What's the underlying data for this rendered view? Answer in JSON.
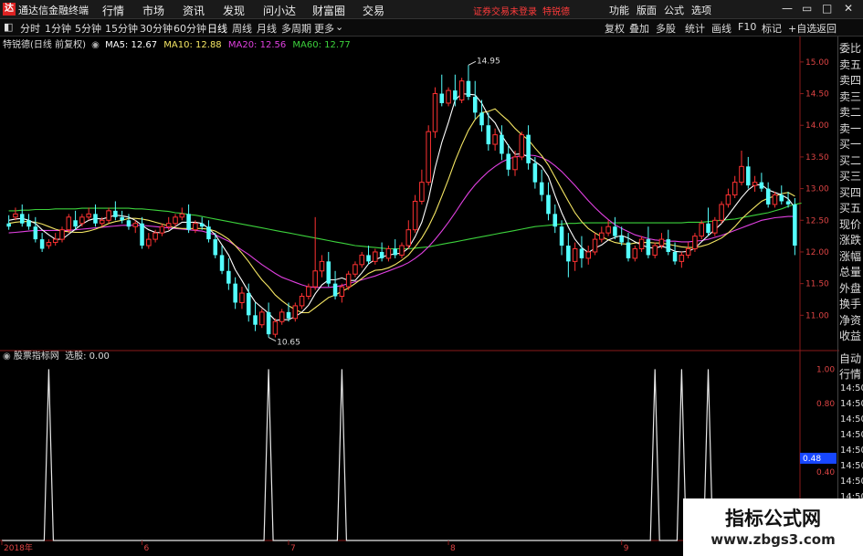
{
  "window": {
    "app_title": "通达信金融终端",
    "menu": [
      "行情",
      "市场",
      "资讯",
      "发现",
      "问小达",
      "财富圈",
      "交易"
    ],
    "notice": "证券交易未登录",
    "notice_user": "特锐德",
    "right_menu": [
      "功能",
      "版面",
      "公式",
      "选项"
    ]
  },
  "toolbar": {
    "periods": [
      "分时",
      "1分钟",
      "5分钟",
      "15分钟",
      "30分钟",
      "60分钟",
      "日线",
      "周线",
      "月线",
      "多周期",
      "更多"
    ],
    "active_period": "日线",
    "right_buttons": [
      "复权",
      "叠加",
      "多股",
      "统计",
      "画线",
      "F10",
      "标记",
      "+自选",
      "返回"
    ]
  },
  "ma_line": {
    "stock": "特锐德(日线 前复权)",
    "ma5": "MA5: 12.67",
    "ma10": "MA10: 12.88",
    "ma20": "MA20: 12.56",
    "ma60": "MA60: 12.77",
    "colors": {
      "ma5": "#ffffff",
      "ma10": "#f5e663",
      "ma20": "#e040e0",
      "ma60": "#3cd23c"
    }
  },
  "lower_panel": {
    "indicator": "股票指标网",
    "signal_label": "选股: 0.00",
    "axis": [
      "1.00",
      "0.80",
      "0.48",
      "0.40",
      "0.20"
    ],
    "current": "0.48"
  },
  "price_axis": [
    "15.00",
    "14.50",
    "14.00",
    "13.50",
    "13.00",
    "12.50",
    "12.00",
    "11.50",
    "11.00"
  ],
  "annotations": {
    "high": "14.95",
    "low": "10.65"
  },
  "date_axis": [
    "2018年",
    "6",
    "7",
    "8",
    "9"
  ],
  "side_panel": {
    "top_labels": [
      "委比",
      "卖五",
      "卖四",
      "卖三",
      "卖二",
      "卖一",
      "买一",
      "买二",
      "买三",
      "买四",
      "买五",
      "现价",
      "涨跌",
      "涨幅",
      "总量",
      "外盘",
      "换手",
      "净资",
      "收益"
    ],
    "bottom_labels": [
      "自动",
      "行情"
    ],
    "times": [
      "14:50",
      "14:50",
      "14:50",
      "14:50",
      "14:50",
      "14:50",
      "14:50",
      "14:50"
    ]
  },
  "watermark": {
    "line1": "指标公式网",
    "line2": "www.zbgs3.com"
  },
  "chart_data": {
    "type": "candlestick",
    "ylim": [
      10.5,
      15.2
    ],
    "candles": [
      [
        12.45,
        12.58,
        12.4,
        12.35
      ],
      [
        12.55,
        12.7,
        12.6,
        12.5
      ],
      [
        12.6,
        12.75,
        12.45,
        12.4
      ],
      [
        12.5,
        12.6,
        12.4,
        12.35
      ],
      [
        12.4,
        12.55,
        12.2,
        12.15
      ],
      [
        12.2,
        12.3,
        12.05,
        12.0
      ],
      [
        12.1,
        12.2,
        12.15,
        12.05
      ],
      [
        12.15,
        12.3,
        12.2,
        12.1
      ],
      [
        12.2,
        12.4,
        12.35,
        12.15
      ],
      [
        12.35,
        12.6,
        12.55,
        12.3
      ],
      [
        12.5,
        12.65,
        12.4,
        12.35
      ],
      [
        12.45,
        12.6,
        12.55,
        12.4
      ],
      [
        12.55,
        12.7,
        12.6,
        12.5
      ],
      [
        12.6,
        12.75,
        12.45,
        12.4
      ],
      [
        12.45,
        12.55,
        12.5,
        12.4
      ],
      [
        12.5,
        12.7,
        12.65,
        12.45
      ],
      [
        12.65,
        12.8,
        12.55,
        12.5
      ],
      [
        12.55,
        12.65,
        12.5,
        12.45
      ],
      [
        12.5,
        12.6,
        12.4,
        12.35
      ],
      [
        12.4,
        12.5,
        12.45,
        12.3
      ],
      [
        12.45,
        12.55,
        12.1,
        12.05
      ],
      [
        12.1,
        12.3,
        12.2,
        12.05
      ],
      [
        12.2,
        12.35,
        12.3,
        12.15
      ],
      [
        12.3,
        12.45,
        12.4,
        12.25
      ],
      [
        12.4,
        12.55,
        12.45,
        12.35
      ],
      [
        12.45,
        12.6,
        12.55,
        12.4
      ],
      [
        12.55,
        12.7,
        12.6,
        12.5
      ],
      [
        12.6,
        12.75,
        12.35,
        12.3
      ],
      [
        12.35,
        12.5,
        12.45,
        12.3
      ],
      [
        12.45,
        12.55,
        12.4,
        12.35
      ],
      [
        12.4,
        12.5,
        12.2,
        12.15
      ],
      [
        12.2,
        12.3,
        11.95,
        11.9
      ],
      [
        11.95,
        12.1,
        11.7,
        11.65
      ],
      [
        11.7,
        11.9,
        11.5,
        11.4
      ],
      [
        11.5,
        11.6,
        11.2,
        11.1
      ],
      [
        11.2,
        11.45,
        11.35,
        11.1
      ],
      [
        11.35,
        11.5,
        11.0,
        10.9
      ],
      [
        11.0,
        11.2,
        10.85,
        10.75
      ],
      [
        10.85,
        11.1,
        11.05,
        10.8
      ],
      [
        11.05,
        11.2,
        10.7,
        10.65
      ],
      [
        10.7,
        10.95,
        10.9,
        10.65
      ],
      [
        10.9,
        11.1,
        11.05,
        10.85
      ],
      [
        11.05,
        11.2,
        10.95,
        10.9
      ],
      [
        10.95,
        11.2,
        11.15,
        10.9
      ],
      [
        11.15,
        11.35,
        11.3,
        11.1
      ],
      [
        11.3,
        11.5,
        11.45,
        11.25
      ],
      [
        11.45,
        12.55,
        11.7,
        11.4
      ],
      [
        11.7,
        11.95,
        11.85,
        11.6
      ],
      [
        11.85,
        12.0,
        11.5,
        11.45
      ],
      [
        11.5,
        11.7,
        11.3,
        11.25
      ],
      [
        11.3,
        11.5,
        11.45,
        11.2
      ],
      [
        11.45,
        11.7,
        11.65,
        11.4
      ],
      [
        11.65,
        11.85,
        11.8,
        11.6
      ],
      [
        11.8,
        12.0,
        11.95,
        11.75
      ],
      [
        11.95,
        12.1,
        11.85,
        11.8
      ],
      [
        11.85,
        12.05,
        12.0,
        11.8
      ],
      [
        12.0,
        12.15,
        11.9,
        11.85
      ],
      [
        11.9,
        12.1,
        12.05,
        11.85
      ],
      [
        12.05,
        12.2,
        11.95,
        11.9
      ],
      [
        11.95,
        12.15,
        12.1,
        11.9
      ],
      [
        12.1,
        12.5,
        12.35,
        12.05
      ],
      [
        12.35,
        12.9,
        12.8,
        12.3
      ],
      [
        12.8,
        13.3,
        13.1,
        12.75
      ],
      [
        13.1,
        14.0,
        13.9,
        13.05
      ],
      [
        13.9,
        14.6,
        14.5,
        13.8
      ],
      [
        14.5,
        14.8,
        14.35,
        14.3
      ],
      [
        14.35,
        14.6,
        14.55,
        14.3
      ],
      [
        14.55,
        14.8,
        14.4,
        14.3
      ],
      [
        14.4,
        14.75,
        14.7,
        14.35
      ],
      [
        14.7,
        14.95,
        14.45,
        14.4
      ],
      [
        14.45,
        14.7,
        14.2,
        14.1
      ],
      [
        14.2,
        14.4,
        14.0,
        13.9
      ],
      [
        14.0,
        14.2,
        13.7,
        13.6
      ],
      [
        13.7,
        13.95,
        13.85,
        13.6
      ],
      [
        13.85,
        14.0,
        13.55,
        13.45
      ],
      [
        13.55,
        13.7,
        13.3,
        13.2
      ],
      [
        13.3,
        13.6,
        13.5,
        13.2
      ],
      [
        13.5,
        13.9,
        13.85,
        13.45
      ],
      [
        13.85,
        14.0,
        13.4,
        13.3
      ],
      [
        13.4,
        13.5,
        13.1,
        13.0
      ],
      [
        13.1,
        13.3,
        12.9,
        12.8
      ],
      [
        12.9,
        13.1,
        12.6,
        12.5
      ],
      [
        12.6,
        12.75,
        12.4,
        12.3
      ],
      [
        12.4,
        12.5,
        12.1,
        11.95
      ],
      [
        12.1,
        12.3,
        11.85,
        11.6
      ],
      [
        11.85,
        12.15,
        12.05,
        11.7
      ],
      [
        12.05,
        12.25,
        11.9,
        11.75
      ],
      [
        11.9,
        12.1,
        12.0,
        11.8
      ],
      [
        12.0,
        12.3,
        12.2,
        11.95
      ],
      [
        12.2,
        12.4,
        12.3,
        12.15
      ],
      [
        12.3,
        12.5,
        12.4,
        12.25
      ],
      [
        12.4,
        12.55,
        12.25,
        12.2
      ],
      [
        12.25,
        12.4,
        12.15,
        12.1
      ],
      [
        12.15,
        12.3,
        11.9,
        11.85
      ],
      [
        11.9,
        12.1,
        12.05,
        11.85
      ],
      [
        12.05,
        12.25,
        12.2,
        12.0
      ],
      [
        12.2,
        12.4,
        11.95,
        11.9
      ],
      [
        11.95,
        12.15,
        12.1,
        11.9
      ],
      [
        12.1,
        12.3,
        12.2,
        12.05
      ],
      [
        12.2,
        12.35,
        12.0,
        11.95
      ],
      [
        12.0,
        12.15,
        11.85,
        11.8
      ],
      [
        11.85,
        12.0,
        11.95,
        11.75
      ],
      [
        11.95,
        12.15,
        12.05,
        11.9
      ],
      [
        12.05,
        12.3,
        12.25,
        12.0
      ],
      [
        12.25,
        12.5,
        12.45,
        12.2
      ],
      [
        12.45,
        12.7,
        12.3,
        12.25
      ],
      [
        12.3,
        12.55,
        12.5,
        12.25
      ],
      [
        12.5,
        12.8,
        12.75,
        12.45
      ],
      [
        12.75,
        13.0,
        12.9,
        12.7
      ],
      [
        12.9,
        13.2,
        13.1,
        12.85
      ],
      [
        13.1,
        13.6,
        13.35,
        13.05
      ],
      [
        13.35,
        13.5,
        13.05,
        13.0
      ],
      [
        13.05,
        13.2,
        13.1,
        12.95
      ],
      [
        13.1,
        13.25,
        13.0,
        12.95
      ],
      [
        13.0,
        13.1,
        12.75,
        12.7
      ],
      [
        12.75,
        12.95,
        12.9,
        12.7
      ],
      [
        12.9,
        13.05,
        12.8,
        12.75
      ],
      [
        12.8,
        12.95,
        12.75,
        12.7
      ],
      [
        12.75,
        12.85,
        12.1,
        11.95
      ]
    ],
    "ma5": [
      12.5,
      12.52,
      12.53,
      12.5,
      12.45,
      12.35,
      12.27,
      12.2,
      12.2,
      12.28,
      12.36,
      12.44,
      12.5,
      12.53,
      12.52,
      12.55,
      12.58,
      12.57,
      12.55,
      12.5,
      12.42,
      12.35,
      12.31,
      12.3,
      12.33,
      12.4,
      12.47,
      12.47,
      12.47,
      12.45,
      12.37,
      12.27,
      12.11,
      11.95,
      11.72,
      11.55,
      11.37,
      11.21,
      11.12,
      11.03,
      10.92,
      10.93,
      10.93,
      10.98,
      11.05,
      11.16,
      11.34,
      11.48,
      11.56,
      11.56,
      11.59,
      11.55,
      11.55,
      11.67,
      11.81,
      11.88,
      11.92,
      11.95,
      11.97,
      11.98,
      12.06,
      12.24,
      12.47,
      12.83,
      13.33,
      13.73,
      14.05,
      14.4,
      14.5,
      14.49,
      14.48,
      14.35,
      14.15,
      14.04,
      13.84,
      13.68,
      13.54,
      13.55,
      13.5,
      13.43,
      13.35,
      13.19,
      12.89,
      12.62,
      12.39,
      12.2,
      12.07,
      11.99,
      12.06,
      12.11,
      12.19,
      12.23,
      12.26,
      12.22,
      12.16,
      12.11,
      12.07,
      12.06,
      12.09,
      12.06,
      12.01,
      12.0,
      12.01,
      12.06,
      12.16,
      12.26,
      12.35,
      12.45,
      12.58,
      12.72,
      12.86,
      12.98,
      13.06,
      13.06,
      12.98,
      12.94,
      12.9,
      12.84,
      12.7
    ],
    "ma10": [
      12.45,
      12.47,
      12.48,
      12.48,
      12.47,
      12.44,
      12.4,
      12.36,
      12.33,
      12.32,
      12.31,
      12.31,
      12.33,
      12.36,
      12.4,
      12.45,
      12.48,
      12.5,
      12.53,
      12.53,
      12.52,
      12.5,
      12.47,
      12.44,
      12.41,
      12.38,
      12.37,
      12.37,
      12.37,
      12.37,
      12.36,
      12.33,
      12.27,
      12.2,
      12.1,
      11.98,
      11.85,
      11.7,
      11.56,
      11.45,
      11.32,
      11.23,
      11.15,
      11.09,
      11.04,
      11.04,
      11.12,
      11.2,
      11.28,
      11.32,
      11.38,
      11.43,
      11.5,
      11.58,
      11.66,
      11.71,
      11.72,
      11.75,
      11.8,
      11.87,
      11.95,
      12.08,
      12.22,
      12.4,
      12.62,
      12.88,
      13.15,
      13.44,
      13.69,
      13.92,
      14.09,
      14.2,
      14.22,
      14.26,
      14.16,
      14.07,
      13.95,
      13.85,
      13.77,
      13.64,
      13.52,
      13.37,
      13.18,
      12.99,
      12.8,
      12.62,
      12.48,
      12.37,
      12.3,
      12.24,
      12.19,
      12.15,
      12.13,
      12.12,
      12.14,
      12.15,
      12.15,
      12.14,
      12.14,
      12.12,
      12.1,
      12.08,
      12.07,
      12.07,
      12.09,
      12.12,
      12.17,
      12.22,
      12.3,
      12.4,
      12.52,
      12.62,
      12.71,
      12.8,
      12.85,
      12.88,
      12.92,
      12.94,
      12.88
    ],
    "ma20": [
      12.3,
      12.31,
      12.32,
      12.33,
      12.34,
      12.34,
      12.34,
      12.34,
      12.34,
      12.34,
      12.35,
      12.36,
      12.37,
      12.38,
      12.39,
      12.4,
      12.41,
      12.42,
      12.42,
      12.42,
      12.42,
      12.41,
      12.4,
      12.39,
      12.38,
      12.37,
      12.36,
      12.35,
      12.34,
      12.33,
      12.3,
      12.27,
      12.22,
      12.17,
      12.1,
      12.03,
      11.96,
      11.88,
      11.8,
      11.73,
      11.66,
      11.6,
      11.56,
      11.52,
      11.48,
      11.45,
      11.44,
      11.44,
      11.44,
      11.45,
      11.47,
      11.5,
      11.53,
      11.56,
      11.59,
      11.62,
      11.66,
      11.7,
      11.74,
      11.78,
      11.83,
      11.9,
      11.98,
      12.08,
      12.2,
      12.33,
      12.47,
      12.62,
      12.78,
      12.93,
      13.06,
      13.17,
      13.27,
      13.35,
      13.42,
      13.47,
      13.5,
      13.52,
      13.53,
      13.52,
      13.49,
      13.44,
      13.36,
      13.27,
      13.16,
      13.05,
      12.93,
      12.81,
      12.7,
      12.6,
      12.51,
      12.43,
      12.37,
      12.32,
      12.27,
      12.24,
      12.21,
      12.19,
      12.18,
      12.17,
      12.17,
      12.16,
      12.16,
      12.17,
      12.18,
      12.2,
      12.23,
      12.26,
      12.3,
      12.34,
      12.38,
      12.42,
      12.46,
      12.5,
      12.52,
      12.54,
      12.55,
      12.56,
      12.56
    ],
    "ma60": [
      12.65,
      12.65,
      12.66,
      12.66,
      12.67,
      12.67,
      12.67,
      12.68,
      12.68,
      12.68,
      12.68,
      12.69,
      12.69,
      12.69,
      12.69,
      12.69,
      12.69,
      12.69,
      12.69,
      12.68,
      12.68,
      12.67,
      12.66,
      12.65,
      12.64,
      12.62,
      12.61,
      12.59,
      12.58,
      12.56,
      12.54,
      12.52,
      12.5,
      12.48,
      12.46,
      12.44,
      12.42,
      12.4,
      12.38,
      12.36,
      12.34,
      12.32,
      12.3,
      12.28,
      12.26,
      12.24,
      12.22,
      12.2,
      12.18,
      12.16,
      12.14,
      12.12,
      12.1,
      12.09,
      12.08,
      12.07,
      12.06,
      12.05,
      12.05,
      12.05,
      12.05,
      12.06,
      12.07,
      12.08,
      12.1,
      12.12,
      12.14,
      12.16,
      12.18,
      12.2,
      12.22,
      12.24,
      12.26,
      12.28,
      12.3,
      12.32,
      12.34,
      12.36,
      12.38,
      12.4,
      12.41,
      12.42,
      12.43,
      12.44,
      12.45,
      12.45,
      12.46,
      12.46,
      12.46,
      12.46,
      12.46,
      12.46,
      12.46,
      12.46,
      12.46,
      12.46,
      12.46,
      12.46,
      12.46,
      12.46,
      12.46,
      12.46,
      12.47,
      12.47,
      12.47,
      12.48,
      12.49,
      12.5,
      12.51,
      12.52,
      12.54,
      12.56,
      12.58,
      12.6,
      12.62,
      12.65,
      12.68,
      12.72,
      12.75,
      12.77
    ],
    "signal": [
      0,
      0,
      0,
      0,
      0,
      0,
      1,
      0,
      0,
      0,
      0,
      0,
      0,
      0,
      0,
      0,
      0,
      0,
      0,
      0,
      0,
      0,
      0,
      0,
      0,
      0,
      0,
      0,
      0,
      0,
      0,
      0,
      0,
      0,
      0,
      0,
      0,
      0,
      0,
      1,
      0,
      0,
      0,
      0,
      0,
      0,
      0,
      0,
      0,
      0,
      0,
      0,
      0,
      0,
      0,
      0,
      0,
      0,
      0,
      0,
      0,
      0,
      0,
      0,
      0,
      0,
      0,
      0,
      0,
      0,
      0,
      0,
      0,
      0,
      0,
      0,
      0,
      0,
      0,
      0,
      0,
      0,
      0,
      0,
      0,
      0,
      0,
      0,
      0,
      0,
      0,
      0,
      0,
      0,
      0,
      0,
      0,
      0,
      0,
      0,
      0,
      0,
      0,
      0,
      0,
      0,
      0,
      0,
      0,
      0,
      0,
      0,
      0,
      0,
      0,
      0,
      0,
      0,
      0
    ],
    "signal_peaks_at": [
      6,
      39,
      50,
      97,
      101,
      105
    ],
    "signal_ylim": [
      0,
      1.05
    ]
  }
}
